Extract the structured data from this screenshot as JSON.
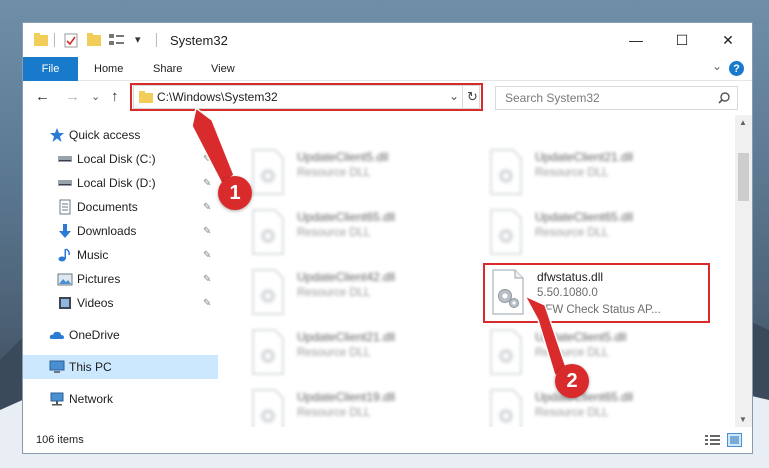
{
  "window": {
    "title": "System32",
    "controls": {
      "minimize": "—",
      "maximize": "☐",
      "close": "✕"
    }
  },
  "ribbon": {
    "file": "File",
    "tabs": [
      "Home",
      "Share",
      "View"
    ],
    "help": "?",
    "collapse": "⌄"
  },
  "nav": {
    "back": "←",
    "forward": "→",
    "recent": "⌄",
    "up": "↑",
    "address": "C:\\Windows\\System32",
    "address_dropdown": "⌄",
    "refresh": "↻",
    "search_placeholder": "Search System32",
    "search_icon": "⌕"
  },
  "sidebar": {
    "items": [
      {
        "label": "Quick access",
        "icon": "star-icon"
      },
      {
        "label": "Local Disk (C:)",
        "icon": "drive-icon",
        "pinned": true
      },
      {
        "label": "Local Disk (D:)",
        "icon": "drive-icon",
        "pinned": true
      },
      {
        "label": "Documents",
        "icon": "documents-icon",
        "pinned": true
      },
      {
        "label": "Downloads",
        "icon": "download-icon",
        "pinned": true
      },
      {
        "label": "Music",
        "icon": "music-icon",
        "pinned": true
      },
      {
        "label": "Pictures",
        "icon": "pictures-icon",
        "pinned": true
      },
      {
        "label": "Videos",
        "icon": "videos-icon",
        "pinned": true
      },
      {
        "label": "OneDrive",
        "icon": "cloud-icon"
      },
      {
        "label": "This PC",
        "icon": "computer-icon",
        "selected": true
      },
      {
        "label": "Network",
        "icon": "network-icon"
      }
    ],
    "pin_glyph": "📌"
  },
  "files": [
    {
      "name": "UpdateClient5.dll",
      "type": "Resource DLL"
    },
    {
      "name": "UpdateClient21.dll",
      "type": "Resource DLL"
    },
    {
      "name": "UpdateClient65.dll",
      "type": "Resource DLL"
    },
    {
      "name": "UpdateClient65.dll",
      "type": "Resource DLL"
    },
    {
      "name": "UpdateClient42.dll",
      "type": "Resource DLL"
    },
    {
      "name": "dfwstatus.dll",
      "version": "5.50.1080.0",
      "type": "DFW Check Status AP...",
      "highlighted": true
    },
    {
      "name": "UpdateClient21.dll",
      "type": "Resource DLL"
    },
    {
      "name": "UpdateClient5.dll",
      "type": "Resource DLL"
    },
    {
      "name": "UpdateClient19.dll",
      "type": "Resource DLL"
    },
    {
      "name": "UpdateClient65.dll",
      "type": "Resource DLL"
    }
  ],
  "status": {
    "items": "106 items"
  },
  "annotations": {
    "badge1": "1",
    "badge2": "2"
  },
  "colors": {
    "accent": "#1979ca",
    "highlight": "#d92b2b",
    "selection": "#cce8ff"
  }
}
